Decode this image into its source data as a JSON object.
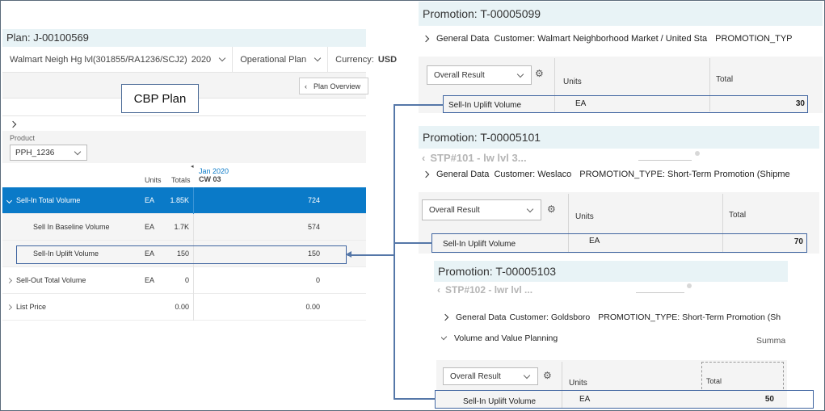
{
  "plan": {
    "title": "Plan: J-00100569",
    "filters": [
      {
        "label": "Walmart Neigh Hg lvl(301855/RA1236/SCJ2)",
        "value": "2020"
      },
      {
        "label": "Operational Plan"
      },
      {
        "label": "Currency:",
        "value": "USD"
      }
    ],
    "overview_button": "Plan Overview",
    "callout": "CBP Plan",
    "product": {
      "label": "Product",
      "value": "PPH_1236"
    },
    "columns": {
      "units": "Units",
      "totals": "Totals",
      "period": "Jan 2020",
      "week": "CW 03"
    },
    "rows": [
      {
        "label": "Sell-In Total Volume",
        "units": "EA",
        "total": "1.85K",
        "value": "724"
      },
      {
        "label": "Sell In Baseline Volume",
        "units": "EA",
        "total": "1.7K",
        "value": "574"
      },
      {
        "label": "Sell-In Uplift Volume",
        "units": "EA",
        "total": "150",
        "value": "150"
      },
      {
        "label": "Sell-Out Total Volume",
        "units": "EA",
        "total": "0",
        "value": "0"
      },
      {
        "label": "List Price",
        "units": "",
        "total": "0.00",
        "value": "0.00"
      }
    ]
  },
  "promo1": {
    "title": "Promotion: T-00005099",
    "general": "General Data",
    "customer_label": "Customer:",
    "customer": "Walmart Neighborhood Market / United Sta",
    "type_label": "PROMOTION_TYP",
    "result_select": "Overall Result",
    "units_header": "Units",
    "total_header": "Total",
    "row_label": "Sell-In Uplift Volume",
    "row_units": "EA",
    "row_total": "30"
  },
  "promo2": {
    "title": "Promotion: T-00005101",
    "stp": "STP#101 - lw lvl 3...",
    "general": "General Data",
    "customer_label": "Customer:",
    "customer": "Weslaco",
    "type_label": "PROMOTION_TYPE:",
    "type": "Short-Term Promotion (Shipme",
    "result_select": "Overall Result",
    "units_header": "Units",
    "total_header": "Total",
    "row_label": "Sell-In Uplift Volume",
    "row_units": "EA",
    "row_total": "70"
  },
  "promo3": {
    "title": "Promotion: T-00005103",
    "stp": "STP#102 - lwr lvl ...",
    "general": "General Data",
    "customer_label": "Customer:",
    "customer": "Goldsboro",
    "type_label": "PROMOTION_TYPE:",
    "type": "Short-Term Promotion (Sh",
    "volume_section": "Volume and Value Planning",
    "summary": "Summa",
    "result_select": "Overall Result",
    "units_header": "Units",
    "total_header": "Total",
    "row_label": "Sell-In Uplift Volume",
    "row_units": "EA",
    "row_total": "50"
  },
  "colors": {
    "accent": "#0a7ac8",
    "title_bg": "#e8f3f6",
    "highlight": "#3f64a0"
  }
}
